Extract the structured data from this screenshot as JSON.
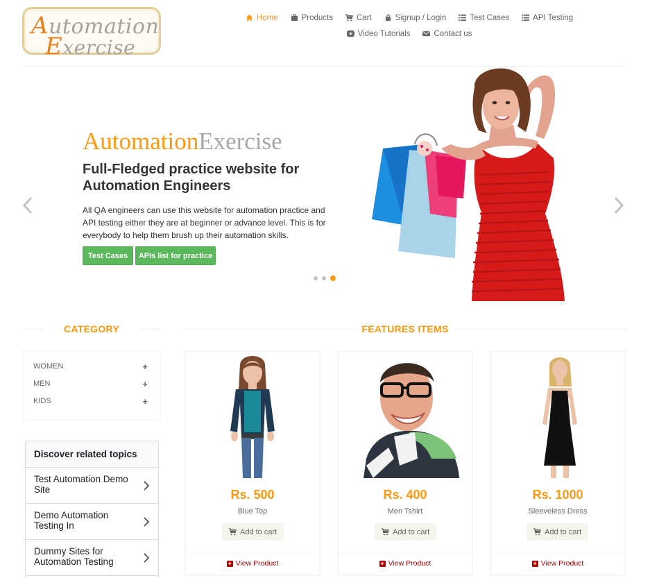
{
  "logo": {
    "line1_cap": "A",
    "line1_rest": "utomation",
    "line2_cap": "E",
    "line2_rest": "xercise"
  },
  "nav": [
    {
      "label": "Home",
      "icon": "home-icon",
      "active": true
    },
    {
      "label": "Products",
      "icon": "products-icon"
    },
    {
      "label": "Cart",
      "icon": "cart-icon"
    },
    {
      "label": "Signup / Login",
      "icon": "lock-icon"
    },
    {
      "label": "Test Cases",
      "icon": "list-icon"
    },
    {
      "label": "API Testing",
      "icon": "list-icon"
    },
    {
      "label": "Video Tutorials",
      "icon": "video-icon"
    },
    {
      "label": "Contact us",
      "icon": "envelope-icon"
    }
  ],
  "slider": {
    "brand_part1": "Automation",
    "brand_part2": "Exercise",
    "headline": "Full-Fledged practice website for Automation Engineers",
    "description": "All QA engineers can use this website for automation practice and API testing either they are at beginner or advance level. This is for everybody to help them brush up their automation skills.",
    "btn_test_cases": "Test Cases",
    "btn_apis": "APIs list for practice",
    "active_slide": 3,
    "slide_count": 3
  },
  "category": {
    "title": "CATEGORY",
    "items": [
      {
        "label": "WOMEN",
        "toggle": "+"
      },
      {
        "label": "MEN",
        "toggle": "+"
      },
      {
        "label": "KIDS",
        "toggle": "+"
      }
    ]
  },
  "discover": {
    "title": "Discover related topics",
    "items": [
      {
        "label": "Test Automation Demo Site"
      },
      {
        "label": "Demo Automation Testing In"
      },
      {
        "label": "Dummy Sites for Automation Testing"
      }
    ]
  },
  "features": {
    "title": "FEATURES ITEMS",
    "add_label": "Add to cart",
    "view_label": "View Product",
    "products": [
      {
        "price": "Rs. 500",
        "name": "Blue Top"
      },
      {
        "price": "Rs. 400",
        "name": "Men Tshirt"
      },
      {
        "price": "Rs. 1000",
        "name": "Sleeveless Dress"
      }
    ]
  },
  "colors": {
    "accent": "#fe980f",
    "button_green": "#5cb85c",
    "view_red": "#b30000",
    "text": "#696763"
  }
}
